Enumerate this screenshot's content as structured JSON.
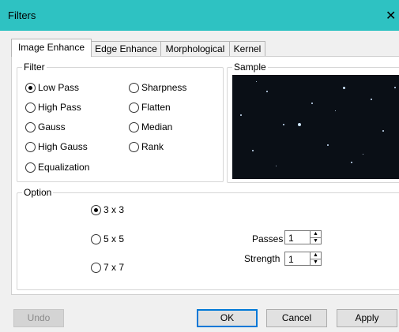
{
  "window": {
    "title": "Filters",
    "close_glyph": "✕"
  },
  "tabs": [
    {
      "label": "Image Enhance",
      "active": true
    },
    {
      "label": "Edge Enhance",
      "active": false
    },
    {
      "label": "Morphological",
      "active": false
    },
    {
      "label": "Kernel",
      "active": false
    }
  ],
  "filter_group": {
    "label": "Filter",
    "options": [
      {
        "label": "Low Pass",
        "checked": true
      },
      {
        "label": "High Pass",
        "checked": false
      },
      {
        "label": "Gauss",
        "checked": false
      },
      {
        "label": "High Gauss",
        "checked": false
      },
      {
        "label": "Equalization",
        "checked": false
      },
      {
        "label": "Sharpness",
        "checked": false
      },
      {
        "label": "Flatten",
        "checked": false
      },
      {
        "label": "Median",
        "checked": false
      },
      {
        "label": "Rank",
        "checked": false
      }
    ]
  },
  "sample_group": {
    "label": "Sample"
  },
  "option_group": {
    "label": "Option",
    "sizes": [
      {
        "label": "3 x 3",
        "checked": true
      },
      {
        "label": "5 x 5",
        "checked": false
      },
      {
        "label": "7 x 7",
        "checked": false
      }
    ],
    "passes": {
      "label": "Passes",
      "value": "1"
    },
    "strength": {
      "label": "Strength",
      "value": "1"
    }
  },
  "buttons": {
    "undo": "Undo",
    "ok": "OK",
    "cancel": "Cancel",
    "apply": "Apply"
  },
  "colors": {
    "titlebar": "#2ec2c2",
    "sample_bg": "#0a0f16",
    "focus": "#0078d7"
  }
}
